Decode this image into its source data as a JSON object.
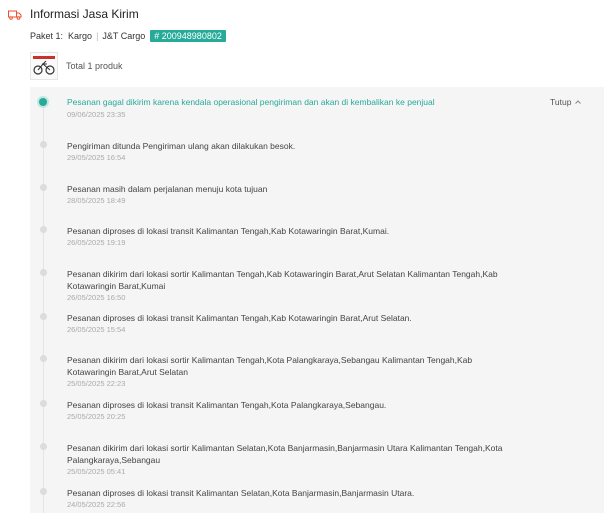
{
  "header": {
    "title": "Informasi Jasa Kirim"
  },
  "paket": {
    "label": "Paket 1:",
    "service": "Kargo",
    "courier": "J&T Cargo",
    "tracking": "# 200948980802"
  },
  "product": {
    "total_text": "Total 1 produk"
  },
  "timeline": {
    "toggle_label": "Tutup",
    "events": [
      {
        "message": "Pesanan gagal dikirim karena kendala operasional pengiriman dan akan di kembalikan ke penjual",
        "time": "09/06/2025 23:35"
      },
      {
        "message": "Pengiriman ditunda Pengiriman ulang akan dilakukan besok.",
        "time": "29/05/2025 16:54"
      },
      {
        "message": "Pesanan masih dalam perjalanan menuju kota tujuan",
        "time": "28/05/2025 18:49"
      },
      {
        "message": "Pesanan diproses di lokasi transit Kalimantan Tengah,Kab Kotawaringin Barat,Kumai.",
        "time": "26/05/2025 19:19"
      },
      {
        "message": "Pesanan dikirim dari lokasi sortir Kalimantan Tengah,Kab Kotawaringin Barat,Arut Selatan Kalimantan Tengah,Kab Kotawaringin Barat,Kumai",
        "time": "26/05/2025 16:50"
      },
      {
        "message": "Pesanan diproses di lokasi transit Kalimantan Tengah,Kab Kotawaringin Barat,Arut Selatan.",
        "time": "26/05/2025 15:54"
      },
      {
        "message": "Pesanan dikirim dari lokasi sortir Kalimantan Tengah,Kota Palangkaraya,Sebangau Kalimantan Tengah,Kab Kotawaringin Barat,Arut Selatan",
        "time": "25/05/2025 22:23"
      },
      {
        "message": "Pesanan diproses di lokasi transit Kalimantan Tengah,Kota Palangkaraya,Sebangau.",
        "time": "25/05/2025 20:25"
      },
      {
        "message": "Pesanan dikirim dari lokasi sortir Kalimantan Selatan,Kota Banjarmasin,Banjarmasin Utara Kalimantan Tengah,Kota Palangkaraya,Sebangau",
        "time": "25/05/2025 05:41"
      },
      {
        "message": "Pesanan diproses di lokasi transit Kalimantan Selatan,Kota Banjarmasin,Banjarmasin Utara.",
        "time": "24/05/2025 22:56"
      }
    ]
  }
}
